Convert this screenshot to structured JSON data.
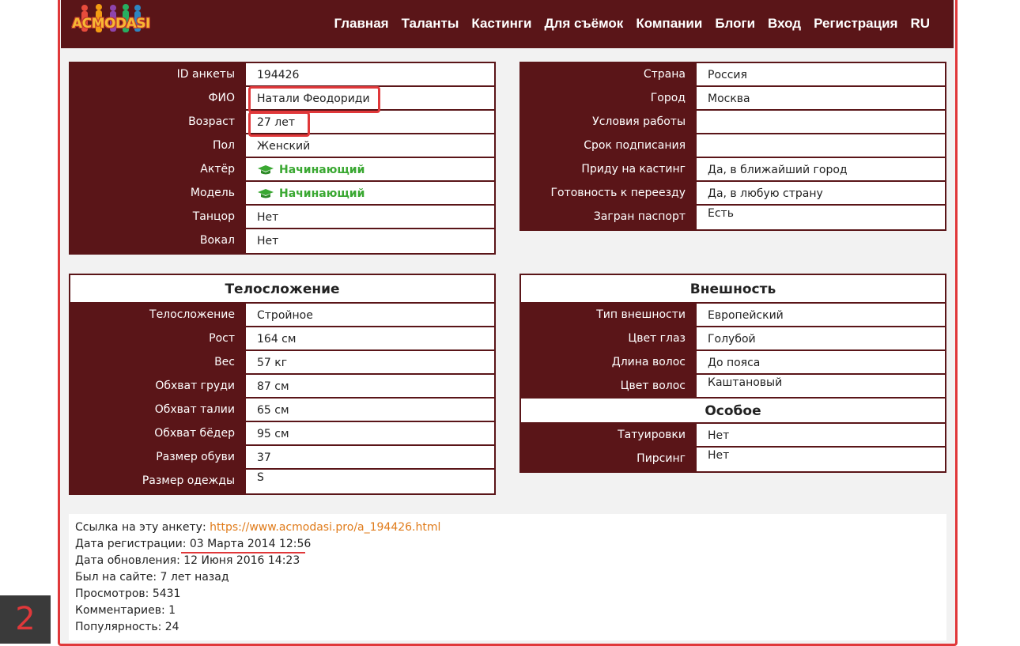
{
  "header": {
    "logo_text": "ACMODASI",
    "nav": [
      "Главная",
      "Таланты",
      "Кастинги",
      "Для съёмок",
      "Компании",
      "Блоги",
      "Вход",
      "Регистрация",
      "RU"
    ]
  },
  "colors": {
    "brand": "#5a1518",
    "highlight": "#e0383a",
    "link": "#e07b1a",
    "level": "#3aa832"
  },
  "profile": [
    {
      "label": "ID анкеты",
      "value": "194426"
    },
    {
      "label": "ФИО",
      "value": "Натали Феодориди"
    },
    {
      "label": "Возраст",
      "value": "27 лет"
    },
    {
      "label": "Пол",
      "value": "Женский"
    },
    {
      "label": "Актёр",
      "value": "Начинающий",
      "icon": "graduation-cap-icon"
    },
    {
      "label": "Модель",
      "value": "Начинающий",
      "icon": "graduation-cap-icon"
    },
    {
      "label": "Танцор",
      "value": "Нет"
    },
    {
      "label": "Вокал",
      "value": "Нет"
    }
  ],
  "location": [
    {
      "label": "Страна",
      "value": "Россия"
    },
    {
      "label": "Город",
      "value": "Москва"
    },
    {
      "label": "Условия работы",
      "value": ""
    },
    {
      "label": "Срок подписания",
      "value": ""
    },
    {
      "label": "Приду на кастинг",
      "value": "Да, в ближайший город"
    },
    {
      "label": "Готовность к переезду",
      "value": "Да, в любую страну"
    },
    {
      "label": "Загран паспорт",
      "value": "Есть"
    }
  ],
  "body": {
    "title": "Телосложение",
    "rows": [
      {
        "label": "Телосложение",
        "value": "Стройное"
      },
      {
        "label": "Рост",
        "value": "164 см"
      },
      {
        "label": "Вес",
        "value": "57 кг"
      },
      {
        "label": "Обхват груди",
        "value": "87 см"
      },
      {
        "label": "Обхват талии",
        "value": "65 см"
      },
      {
        "label": "Обхват бёдер",
        "value": "95 см"
      },
      {
        "label": "Размер обуви",
        "value": "37"
      },
      {
        "label": "Размер одежды",
        "value": "S"
      }
    ]
  },
  "appearance": {
    "title": "Внешность",
    "rows": [
      {
        "label": "Тип внешности",
        "value": "Европейский"
      },
      {
        "label": "Цвет глаз",
        "value": "Голубой"
      },
      {
        "label": "Длина волос",
        "value": "До пояса"
      },
      {
        "label": "Цвет волос",
        "value": "Каштановый"
      }
    ]
  },
  "special": {
    "title": "Особое",
    "rows": [
      {
        "label": "Татуировки",
        "value": "Нет"
      },
      {
        "label": "Пирсинг",
        "value": "Нет"
      }
    ]
  },
  "info": {
    "link_label": "Ссылка на эту анкету: ",
    "link_url": "https://www.acmodasi.pro/a_194426.html",
    "lines": [
      "Дата регистрации: 03 Марта 2014 12:56",
      "Дата обновления: 12 Июня 2016 14:23",
      "Был на сайте: 7 лет назад",
      "Просмотров: 5431",
      "Комментариев: 1",
      "Популярность: 24"
    ]
  },
  "badge": "2"
}
